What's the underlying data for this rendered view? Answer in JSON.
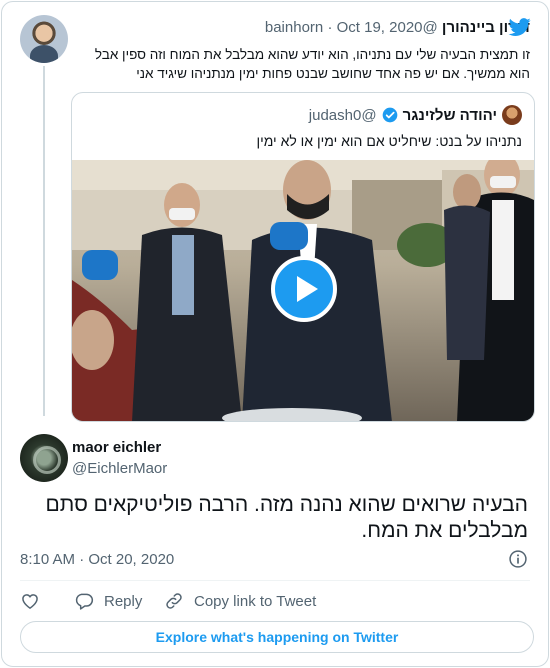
{
  "colors": {
    "accent": "#1d9bf0",
    "text": "#0f1419",
    "secondary": "#536471",
    "border": "#cfd9de"
  },
  "parent_tweet": {
    "display_name": "דורון ביינהורן",
    "handle": "@bainhorn",
    "date": "Oct 19, 2020",
    "text": "זו תמצית הבעיה שלי עם נתניהו, הוא יודע שהוא מבלבל את המוח וזה ספין אבל הוא ממשיך. אם יש פה אחד שחושב שבנט פחות ימין מנתניהו שיגיד אני",
    "logo_icon": "twitter-bird-icon"
  },
  "quoted_tweet": {
    "display_name": "יהודה שלזינגר",
    "handle": "@judash0",
    "verified_icon": "verified-badge-icon",
    "text": "נתניהו על בנט: שיחליט אם הוא ימין או לא ימין",
    "media": {
      "type": "video",
      "play_icon": "play-icon"
    }
  },
  "main_tweet": {
    "display_name": "maor eichler",
    "handle": "@EichlerMaor",
    "text": "הבעיה שרואים שהוא נהנה מזה. הרבה פוליטיקאים סתם מבלבלים את המח.",
    "time": "8:10 AM · Oct 20, 2020",
    "info_icon": "info-icon"
  },
  "actions": {
    "like_icon": "heart-icon",
    "reply_label": "Reply",
    "copy_label": "Copy link to Tweet"
  },
  "explore_label": "Explore what's happening on Twitter"
}
